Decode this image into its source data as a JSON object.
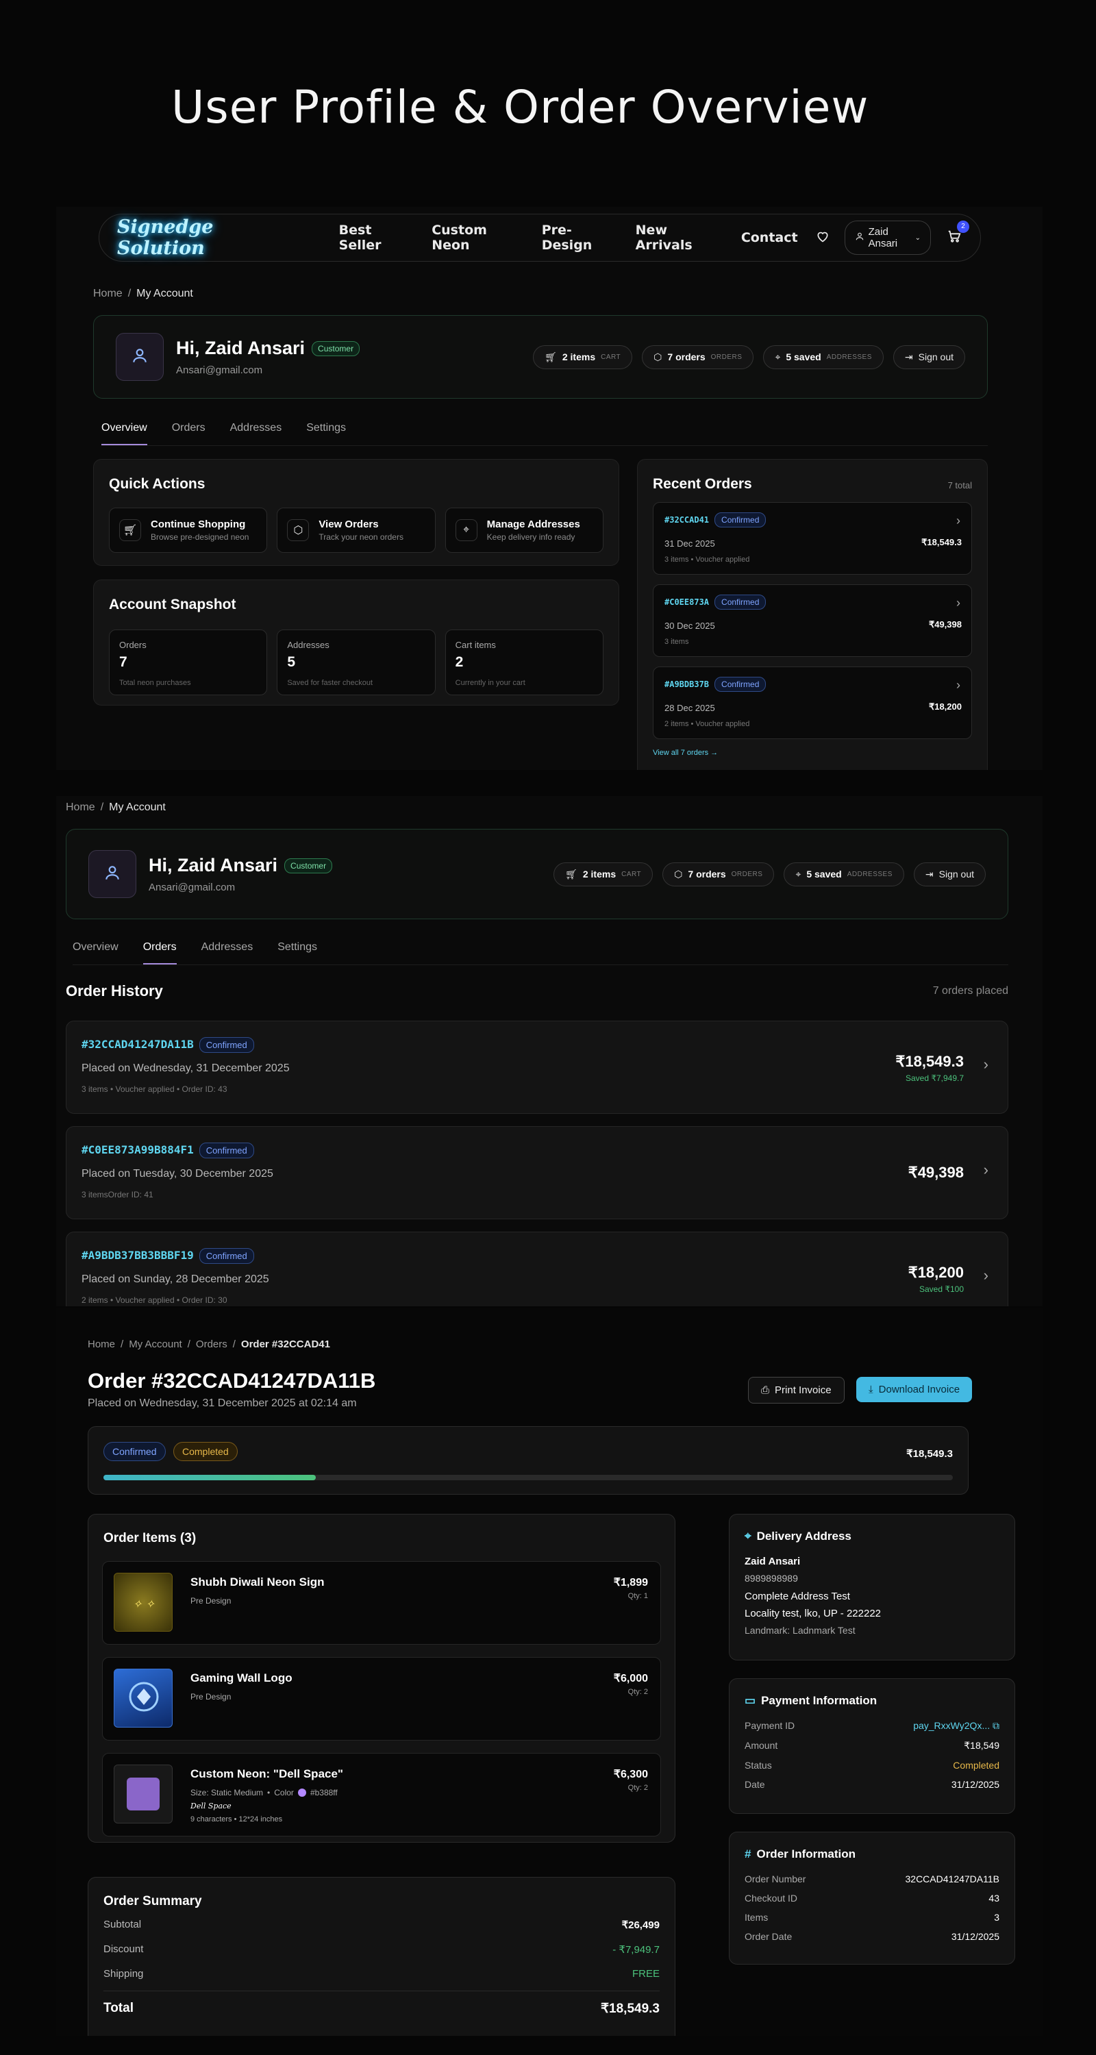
{
  "hero_title": "User Profile & Order Overview",
  "brand": {
    "logo": "Signedge Solution",
    "neon_color": "#35c4ff",
    "accent": "#4fc4e8"
  },
  "nav": {
    "links": [
      "Best Seller",
      "Custom Neon",
      "Pre-Design",
      "New Arrivals",
      "Contact"
    ],
    "user": "Zaid Ansari",
    "cart_count": "2",
    "icons": [
      "heart-icon",
      "user-icon",
      "chevron-down-icon",
      "cart-icon"
    ]
  },
  "breadcrumb_account": {
    "home": "Home",
    "sep": "/",
    "current": "My Account"
  },
  "profile": {
    "greeting": "Hi, Zaid Ansari",
    "role": "Customer",
    "email": "Ansari@gmail.com",
    "chips": {
      "cart": {
        "value": "2 items",
        "label": "CART"
      },
      "orders": {
        "value": "7 orders",
        "label": "ORDERS"
      },
      "saved": {
        "value": "5 saved",
        "label": "ADDRESSES"
      },
      "signout": "Sign out"
    }
  },
  "tabs": [
    "Overview",
    "Orders",
    "Addresses",
    "Settings"
  ],
  "quick_actions": {
    "title": "Quick Actions",
    "items": [
      {
        "title": "Continue Shopping",
        "sub": "Browse pre-designed neon"
      },
      {
        "title": "View Orders",
        "sub": "Track your neon orders"
      },
      {
        "title": "Manage Addresses",
        "sub": "Keep delivery info ready"
      }
    ]
  },
  "snapshot": {
    "title": "Account Snapshot",
    "items": [
      {
        "label": "Orders",
        "value": "7",
        "hint": "Total neon purchases"
      },
      {
        "label": "Addresses",
        "value": "5",
        "hint": "Saved for faster checkout"
      },
      {
        "label": "Cart items",
        "value": "2",
        "hint": "Currently in your cart"
      }
    ]
  },
  "recent_orders": {
    "title": "Recent Orders",
    "total": "7 total",
    "items": [
      {
        "id": "#32CCAD41",
        "status": "Confirmed",
        "date": "31 Dec 2025",
        "amount": "₹18,549.3",
        "meta": "3 items • Voucher applied"
      },
      {
        "id": "#C0EE873A",
        "status": "Confirmed",
        "date": "30 Dec 2025",
        "amount": "₹49,398",
        "meta": "3 items"
      },
      {
        "id": "#A9BDB37B",
        "status": "Confirmed",
        "date": "28 Dec 2025",
        "amount": "₹18,200",
        "meta": "2 items • Voucher applied"
      }
    ],
    "view_all": "View all 7 orders →"
  },
  "order_history": {
    "title": "Order History",
    "count": "7 orders placed",
    "items": [
      {
        "id": "#32CCAD41247DA11B",
        "status": "Confirmed",
        "placed": "Placed on Wednesday, 31 December 2025",
        "meta": "3 items • Voucher applied • Order ID: 43",
        "amount": "₹18,549.3",
        "saved": "Saved ₹7,949.7"
      },
      {
        "id": "#C0EE873A99B884F1",
        "status": "Confirmed",
        "placed": "Placed on Tuesday, 30 December 2025",
        "meta": "3 itemsOrder ID: 41",
        "amount": "₹49,398",
        "saved": ""
      },
      {
        "id": "#A9BDB37BB3BBBF19",
        "status": "Confirmed",
        "placed": "Placed on Sunday, 28 December 2025",
        "meta": "2 items • Voucher applied • Order ID: 30",
        "amount": "₹18,200",
        "saved": "Saved ₹100"
      }
    ]
  },
  "order_detail": {
    "breadcrumb": [
      "Home",
      "My Account",
      "Orders",
      "Order #32CCAD41"
    ],
    "title": "Order #32CCAD41247DA11B",
    "placed": "Placed on Wednesday, 31 December 2025 at 02:14 am",
    "print_label": "Print Invoice",
    "download_label": "Download Invoice",
    "status_badges": [
      "Confirmed",
      "Completed"
    ],
    "total": "₹18,549.3",
    "progress_fraction": 0.25,
    "items_title": "Order Items (3)",
    "items": [
      {
        "name": "Shubh Diwali Neon Sign",
        "type": "Pre Design",
        "price": "₹1,899",
        "qty": "Qty: 1"
      },
      {
        "name": "Gaming Wall Logo",
        "type": "Pre Design",
        "price": "₹6,000",
        "qty": "Qty: 2"
      },
      {
        "name": "Custom Neon: \"Dell Space\"",
        "size": "Size: Static Medium",
        "color_label": "Color",
        "color_hex": "#b388ff",
        "preview": "Dell Space",
        "chars": "9 characters • 12*24 inches",
        "price": "₹6,300",
        "qty": "Qty: 2"
      }
    ],
    "summary": {
      "title": "Order Summary",
      "subtotal_label": "Subtotal",
      "subtotal": "₹26,499",
      "discount_label": "Discount",
      "discount": "- ₹7,949.7",
      "shipping_label": "Shipping",
      "shipping": "FREE",
      "total_label": "Total",
      "total": "₹18,549.3"
    },
    "delivery": {
      "title": "Delivery Address",
      "name": "Zaid Ansari",
      "phone": "8989898989",
      "line1": "Complete Address Test",
      "line2": "Locality test, lko, UP - 222222",
      "landmark": "Landmark: Ladnmark Test"
    },
    "payment": {
      "title": "Payment Information",
      "rows": [
        {
          "k": "Payment ID",
          "v": "pay_RxxWy2Qx..."
        },
        {
          "k": "Amount",
          "v": "₹18,549"
        },
        {
          "k": "Status",
          "v": "Completed"
        },
        {
          "k": "Date",
          "v": "31/12/2025"
        }
      ]
    },
    "order_info": {
      "title": "Order Information",
      "rows": [
        {
          "k": "Order Number",
          "v": "32CCAD41247DA11B"
        },
        {
          "k": "Checkout ID",
          "v": "43"
        },
        {
          "k": "Items",
          "v": "3"
        },
        {
          "k": "Order Date",
          "v": "31/12/2025"
        }
      ]
    }
  }
}
